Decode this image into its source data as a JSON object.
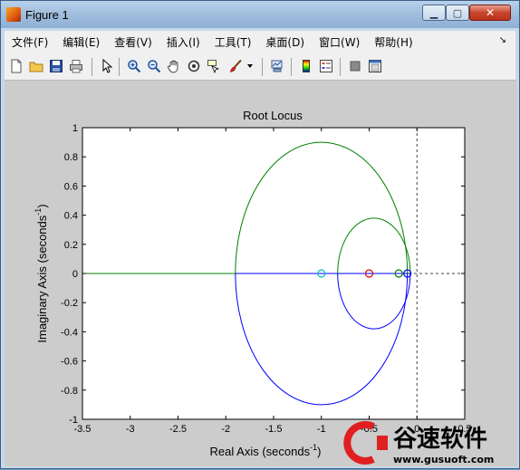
{
  "window": {
    "title": "Figure 1",
    "buttons": {
      "minimize": "▁",
      "maximize": "▢",
      "close": "✕"
    }
  },
  "menu": {
    "items": [
      "文件(F)",
      "编辑(E)",
      "查看(V)",
      "插入(I)",
      "工具(T)",
      "桌面(D)",
      "窗口(W)",
      "帮助(H)"
    ],
    "overflow": "↘"
  },
  "toolbar": {
    "icons": [
      "new-figure-icon",
      "open-file-icon",
      "save-icon",
      "print-icon",
      "pointer-icon",
      "zoom-in-icon",
      "zoom-out-icon",
      "pan-hand-icon",
      "rotate-3d-icon",
      "data-cursor-icon",
      "brush-icon",
      "brush-dropdown-icon",
      "link-plot-icon",
      "colorbar-icon",
      "legend-icon",
      "hide-plot-tools-icon",
      "show-plot-tools-icon"
    ]
  },
  "colors": {
    "branch_green": "#008000",
    "branch_blue": "#0000ff",
    "zero_red": "#e00000",
    "zero_cyan": "#00bfbf",
    "watermark_red": "#e02020"
  },
  "chart_data": {
    "type": "line",
    "title": "Root Locus",
    "xlabel": "Real Axis (seconds",
    "xlabel_sup": "-1",
    "xlabel_tail": ")",
    "ylabel": "Imaginary Axis (seconds",
    "ylabel_sup": "-1",
    "ylabel_tail": ")",
    "xlim": [
      -3.5,
      0.5
    ],
    "ylim": [
      -1,
      1
    ],
    "xticks": [
      "-3.5",
      "-3",
      "-2.5",
      "-2",
      "-1.5",
      "-1",
      "-0.5",
      "0",
      "0.5"
    ],
    "xtick_values": [
      -3.5,
      -3,
      -2.5,
      -2,
      -1.5,
      -1,
      -0.5,
      0,
      0.5
    ],
    "yticks": [
      "1",
      "0.8",
      "0.6",
      "0.4",
      "0.2",
      "0",
      "-0.2",
      "-0.4",
      "-0.6",
      "-0.8",
      "-1"
    ],
    "ytick_values": [
      1,
      0.8,
      0.6,
      0.4,
      0.2,
      0,
      -0.2,
      -0.4,
      -0.6,
      -0.8,
      -1
    ],
    "grid": false,
    "markers": [
      {
        "name": "zero",
        "x": -1.0,
        "y": 0,
        "color": "#00bfbf"
      },
      {
        "name": "zero",
        "x": -0.5,
        "y": 0,
        "color": "#e00000"
      },
      {
        "name": "zero",
        "x": -0.19,
        "y": 0,
        "color": "#008000"
      },
      {
        "name": "zero",
        "x": -0.1,
        "y": 0,
        "color": "#0000ff"
      }
    ],
    "loops": [
      {
        "center": -1.0,
        "radius": 0.9,
        "color_upper": "#008000",
        "color_lower": "#0000ff"
      },
      {
        "center": -0.45,
        "radius": 0.38,
        "color_upper": "#008000",
        "color_lower": "#0000ff"
      }
    ],
    "real_axis_branches": [
      {
        "from": -3.5,
        "to": -1.9,
        "color": "#008000"
      },
      {
        "from": -1.9,
        "to": -0.08,
        "color": "#0000ff"
      }
    ],
    "reference_lines": {
      "vertical_x": 0,
      "horizontal_y": 0
    }
  },
  "watermark": {
    "brand": "谷速软件",
    "url": "www.gusuoft.com"
  }
}
